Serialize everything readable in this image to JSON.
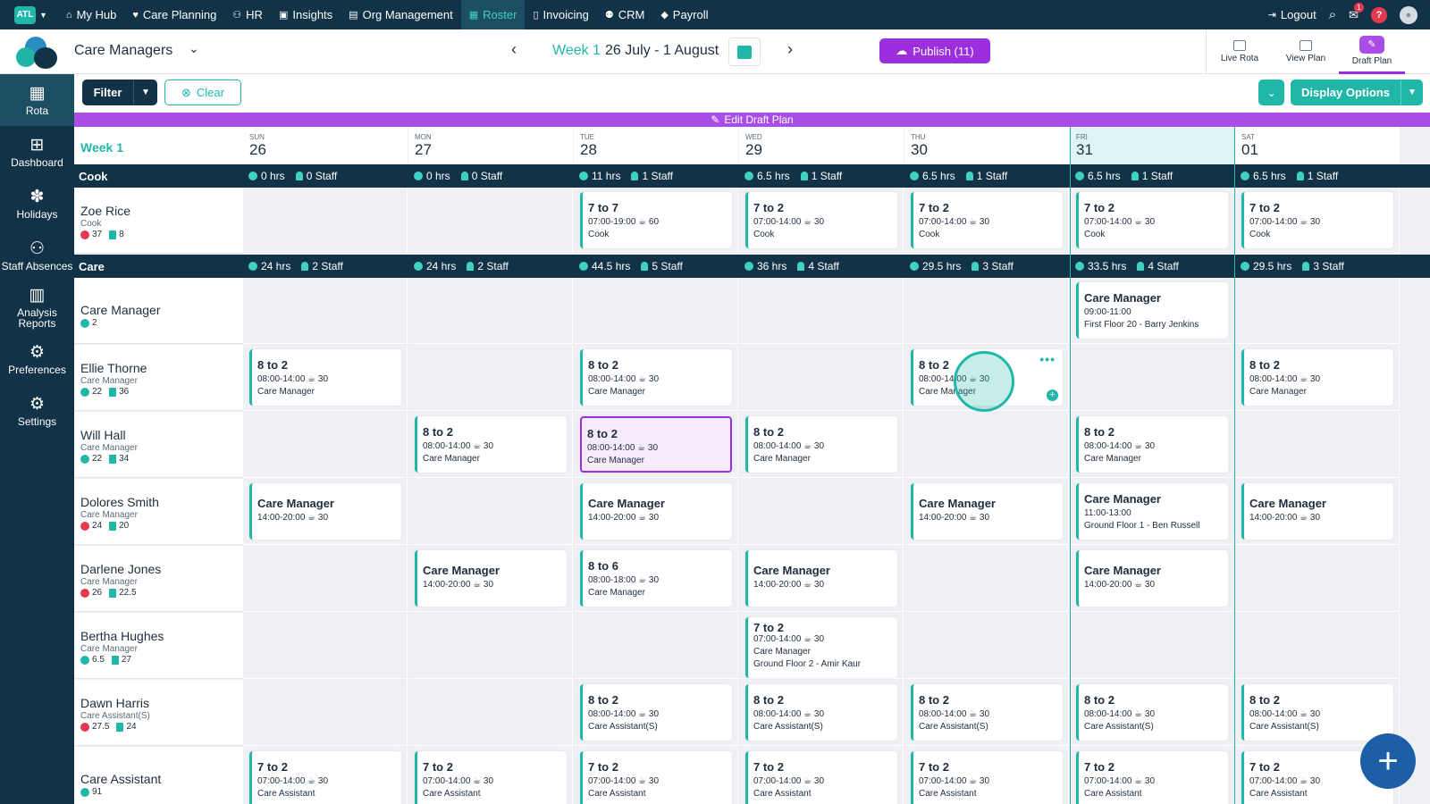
{
  "nav": {
    "logo": "ATL",
    "items": [
      {
        "label": "My Hub",
        "icon": "home-icon"
      },
      {
        "label": "Care Planning",
        "icon": "heart-icon"
      },
      {
        "label": "HR",
        "icon": "people-icon"
      },
      {
        "label": "Insights",
        "icon": "chart-icon"
      },
      {
        "label": "Org Management",
        "icon": "building-icon"
      },
      {
        "label": "Roster",
        "icon": "calendar-icon",
        "active": true
      },
      {
        "label": "Invoicing",
        "icon": "document-icon"
      },
      {
        "label": "CRM",
        "icon": "user-icon"
      },
      {
        "label": "Payroll",
        "icon": "money-icon"
      }
    ],
    "logout": "Logout",
    "mail_badge": "1",
    "help": "?"
  },
  "header": {
    "selector": "Care Managers",
    "week_label": "Week 1",
    "week_range": "26 July - 1 August",
    "publish": "Publish (11)",
    "views": [
      "Live Rota",
      "View Plan",
      "Draft Plan"
    ]
  },
  "sidebar": [
    {
      "label": "Rota",
      "icon": "calendar-icon"
    },
    {
      "label": "Dashboard",
      "icon": "dashboard-icon"
    },
    {
      "label": "Holidays",
      "icon": "palm-tree-icon"
    },
    {
      "label": "Staff Absences",
      "icon": "absence-icon"
    },
    {
      "label": "Analysis Reports",
      "icon": "report-icon"
    },
    {
      "label": "Preferences",
      "icon": "preferences-icon"
    },
    {
      "label": "Settings",
      "icon": "gear-icon"
    }
  ],
  "toolbar": {
    "filter": "Filter",
    "clear": "Clear",
    "display": "Display Options"
  },
  "draft_bar": "Edit Draft Plan",
  "grid": {
    "week": "Week 1",
    "days": [
      {
        "name": "SUN",
        "num": "26"
      },
      {
        "name": "MON",
        "num": "27"
      },
      {
        "name": "TUE",
        "num": "28"
      },
      {
        "name": "WED",
        "num": "29"
      },
      {
        "name": "THU",
        "num": "30"
      },
      {
        "name": "FRI",
        "num": "31",
        "today": true
      },
      {
        "name": "SAT",
        "num": "01"
      }
    ],
    "sections": [
      {
        "label": "Cook",
        "stats": [
          [
            "0 hrs",
            "0 Staff"
          ],
          [
            "0 hrs",
            "0 Staff"
          ],
          [
            "11 hrs",
            "1 Staff"
          ],
          [
            "6.5 hrs",
            "1 Staff"
          ],
          [
            "6.5 hrs",
            "1 Staff"
          ],
          [
            "6.5 hrs",
            "1 Staff"
          ],
          [
            "6.5 hrs",
            "1 Staff"
          ]
        ]
      },
      {
        "label": "Care",
        "stats": [
          [
            "24 hrs",
            "2 Staff"
          ],
          [
            "24 hrs",
            "2 Staff"
          ],
          [
            "44.5 hrs",
            "5 Staff"
          ],
          [
            "36 hrs",
            "4 Staff"
          ],
          [
            "29.5 hrs",
            "3 Staff"
          ],
          [
            "33.5 hrs",
            "4 Staff"
          ],
          [
            "29.5 hrs",
            "3 Staff"
          ]
        ]
      }
    ],
    "rows": [
      {
        "name": "Zoe Rice",
        "role": "Cook",
        "stat1": "37",
        "stat1_color": "red",
        "stat2": "8",
        "shifts": [
          null,
          null,
          {
            "title": "7 to 7",
            "line1": "07:00-19:00 ☕ 60",
            "line2": "Cook"
          },
          {
            "title": "7 to 2",
            "line1": "07:00-14:00 ☕ 30",
            "line2": "Cook"
          },
          {
            "title": "7 to 2",
            "line1": "07:00-14:00 ☕ 30",
            "line2": "Cook"
          },
          {
            "title": "7 to 2",
            "line1": "07:00-14:00 ☕ 30",
            "line2": "Cook"
          },
          {
            "title": "7 to 2",
            "line1": "07:00-14:00 ☕ 30",
            "line2": "Cook"
          }
        ]
      },
      {
        "name": "Care Manager",
        "role": "",
        "stat1": "2",
        "stat1_color": "teal",
        "stat2": "",
        "shifts": [
          null,
          null,
          null,
          null,
          null,
          {
            "title": "Care Manager",
            "line1": "09:00-11:00",
            "line2": "First Floor 20 - Barry Jenkins"
          },
          null
        ]
      },
      {
        "name": "Ellie Thorne",
        "role": "Care Manager",
        "stat1": "22",
        "stat1_color": "teal",
        "stat2": "36",
        "shifts": [
          {
            "title": "8 to 2",
            "line1": "08:00-14:00 ☕ 30",
            "line2": "Care Manager"
          },
          null,
          {
            "title": "8 to 2",
            "line1": "08:00-14:00 ☕ 30",
            "line2": "Care Manager"
          },
          null,
          {
            "title": "8 to 2",
            "line1": "08:00-14:00 ☕ 30",
            "line2": "Care Manager",
            "hover": true
          },
          null,
          {
            "title": "8 to 2",
            "line1": "08:00-14:00 ☕ 30",
            "line2": "Care Manager"
          }
        ]
      },
      {
        "name": "Will Hall",
        "role": "Care Manager",
        "stat1": "22",
        "stat1_color": "teal",
        "stat2": "34",
        "shifts": [
          null,
          {
            "title": "8 to 2",
            "line1": "08:00-14:00 ☕ 30",
            "line2": "Care Manager"
          },
          {
            "title": "8 to 2",
            "line1": "08:00-14:00 ☕ 30",
            "line2": "Care Manager",
            "selected": true
          },
          {
            "title": "8 to 2",
            "line1": "08:00-14:00 ☕ 30",
            "line2": "Care Manager"
          },
          null,
          {
            "title": "8 to 2",
            "line1": "08:00-14:00 ☕ 30",
            "line2": "Care Manager"
          },
          null
        ]
      },
      {
        "name": "Dolores Smith",
        "role": "Care Manager",
        "stat1": "24",
        "stat1_color": "red",
        "stat2": "20",
        "shifts": [
          {
            "title": "Care Manager",
            "line1": "14:00-20:00 ☕ 30",
            "big": true
          },
          null,
          {
            "title": "Care Manager",
            "line1": "14:00-20:00 ☕ 30",
            "big": true
          },
          null,
          {
            "title": "Care Manager",
            "line1": "14:00-20:00 ☕ 30",
            "big": true
          },
          {
            "title": "Care Manager",
            "line1": "11:00-13:00",
            "line2": "Ground Floor 1 - Ben Russell"
          },
          {
            "title": "Care Manager",
            "line1": "14:00-20:00 ☕ 30",
            "big": true
          }
        ]
      },
      {
        "name": "Darlene Jones",
        "role": "Care Manager",
        "stat1": "26",
        "stat1_color": "red",
        "stat2": "22.5",
        "shifts": [
          null,
          {
            "title": "Care Manager",
            "line1": "14:00-20:00 ☕ 30",
            "big": true
          },
          {
            "title": "8 to 6",
            "line1": "08:00-18:00 ☕ 30",
            "line2": "Care Manager"
          },
          {
            "title": "Care Manager",
            "line1": "14:00-20:00 ☕ 30",
            "big": true
          },
          null,
          {
            "title": "Care Manager",
            "line1": "14:00-20:00 ☕ 30",
            "big": true
          },
          null
        ]
      },
      {
        "name": "Bertha Hughes",
        "role": "Care Manager",
        "stat1": "6.5",
        "stat1_color": "teal",
        "stat2": "27",
        "shifts": [
          null,
          null,
          null,
          {
            "title": "7 to 2",
            "line1": "07:00-14:00 ☕ 30",
            "line2": "Care Manager",
            "line3": "Ground Floor 2 - Amir Kaur",
            "tall": true
          },
          null,
          null,
          null
        ]
      },
      {
        "name": "Dawn Harris",
        "role": "Care Assistant(S)",
        "stat1": "27.5",
        "stat1_color": "red",
        "stat2": "24",
        "shifts": [
          null,
          null,
          {
            "title": "8 to 2",
            "line1": "08:00-14:00 ☕ 30",
            "line2": "Care Assistant(S)"
          },
          {
            "title": "8 to 2",
            "line1": "08:00-14:00 ☕ 30",
            "line2": "Care Assistant(S)"
          },
          {
            "title": "8 to 2",
            "line1": "08:00-14:00 ☕ 30",
            "line2": "Care Assistant(S)"
          },
          {
            "title": "8 to 2",
            "line1": "08:00-14:00 ☕ 30",
            "line2": "Care Assistant(S)"
          },
          {
            "title": "8 to 2",
            "line1": "08:00-14:00 ☕ 30",
            "line2": "Care Assistant(S)"
          }
        ]
      },
      {
        "name": "Care Assistant",
        "role": "",
        "stat1": "91",
        "stat1_color": "teal",
        "stat2": "",
        "shifts": [
          {
            "title": "7 to 2",
            "line1": "07:00-14:00 ☕ 30",
            "line2": "Care Assistant"
          },
          {
            "title": "7 to 2",
            "line1": "07:00-14:00 ☕ 30",
            "line2": "Care Assistant"
          },
          {
            "title": "7 to 2",
            "line1": "07:00-14:00 ☕ 30",
            "line2": "Care Assistant"
          },
          {
            "title": "7 to 2",
            "line1": "07:00-14:00 ☕ 30",
            "line2": "Care Assistant"
          },
          {
            "title": "7 to 2",
            "line1": "07:00-14:00 ☕ 30",
            "line2": "Care Assistant"
          },
          {
            "title": "7 to 2",
            "line1": "07:00-14:00 ☕ 30",
            "line2": "Care Assistant"
          },
          {
            "title": "7 to 2",
            "line1": "07:00-14:00 ☕ 30",
            "line2": "Care Assistant"
          }
        ]
      }
    ]
  }
}
